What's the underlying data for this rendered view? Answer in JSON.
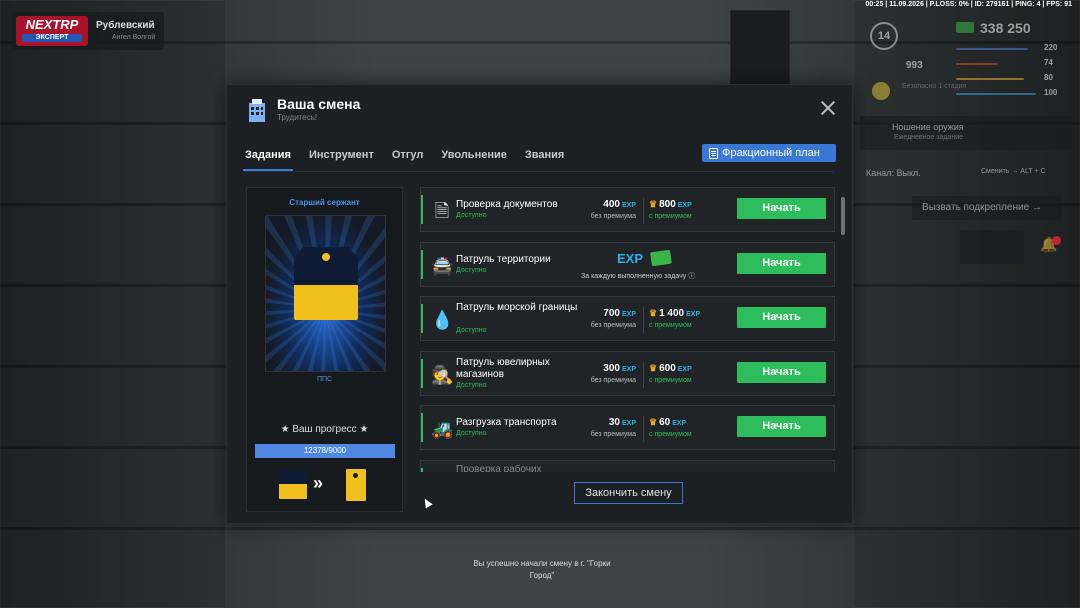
{
  "statusbar": "00:25 | 11.09.2026 | P.LOSS: 0% | ID: 279161 | PING: 4 | FPS: 91",
  "logo": {
    "brand": "NEXTRP",
    "tag": "ЭКСПЕРТ",
    "server": "Рублевский",
    "server_sub": "Ангел Волгой"
  },
  "hud": {
    "level": "14",
    "money": "338 250",
    "hp": "993",
    "hunger_text": "Безопасно 1 стадия",
    "bars": [
      {
        "value": "220",
        "color": "#4a7fd6",
        "fill": 0.85
      },
      {
        "value": "74",
        "color": "#d94a3a",
        "fill": 0.5
      },
      {
        "value": "80",
        "color": "#e2b833",
        "fill": 0.8
      },
      {
        "value": "100",
        "color": "#3aa3d9",
        "fill": 1.0
      }
    ]
  },
  "right": {
    "weapon": "Ношение оружия",
    "weapon_sub": "Ежедневное задание",
    "channel": "Канал: Выкл.",
    "radio": "Сменить → ALT + C",
    "backup": "Вызвать подкрепление →"
  },
  "modal": {
    "title": "Ваша смена",
    "subtitle": "Трудитесь!",
    "tabs": [
      "Задания",
      "Инструмент",
      "Отгул",
      "Увольнение",
      "Звания"
    ],
    "plan_button": "Фракционный план",
    "finish_button": "Закончить смену",
    "rank": {
      "name": "Старший сержант",
      "unit": "ППС",
      "progress_label": "★ Ваш прогресс ★",
      "progress_text": "12378/9000",
      "progress_fill": 1.0
    },
    "tasks": [
      {
        "icon": "document-icon",
        "glyph": "🗎",
        "name": "Проверка документов",
        "status": "Доступно",
        "base": "400",
        "premium": "800",
        "base_label": "без премиума",
        "premium_label": "с премиумом",
        "button": "Начать"
      },
      {
        "icon": "car-icon",
        "glyph": "🚔",
        "name": "Патруль территории",
        "status": "Доступно",
        "special": "За каждую выполненную задачу ⓘ",
        "exp": "EXP",
        "button": "Начать"
      },
      {
        "icon": "drop-icon",
        "glyph": "💧",
        "name": "Патруль морской границы",
        "status": "Доступно",
        "base": "700",
        "premium": "1 400",
        "base_label": "без премиума",
        "premium_label": "с премиумом",
        "button": "Начать"
      },
      {
        "icon": "thief-icon",
        "glyph": "🕵",
        "name": "Патруль ювелирных магазинов",
        "status": "Доступно",
        "base": "300",
        "premium": "600",
        "base_label": "без премиума",
        "premium_label": "с премиумом",
        "button": "Начать"
      },
      {
        "icon": "forklift-icon",
        "glyph": "🚜",
        "name": "Разгрузка транспорта",
        "status": "Доступно",
        "base": "30",
        "premium": "60",
        "base_label": "без премиума",
        "premium_label": "с премиумом",
        "button": "Начать"
      },
      {
        "icon": "worker-icon",
        "glyph": "👷",
        "name": "Проверка рабочих",
        "status": "",
        "base": "",
        "premium": "",
        "button": ""
      }
    ],
    "exp_unit": "EXP"
  },
  "toast": "Вы успешно начали смену в г. \"Горки Город\""
}
